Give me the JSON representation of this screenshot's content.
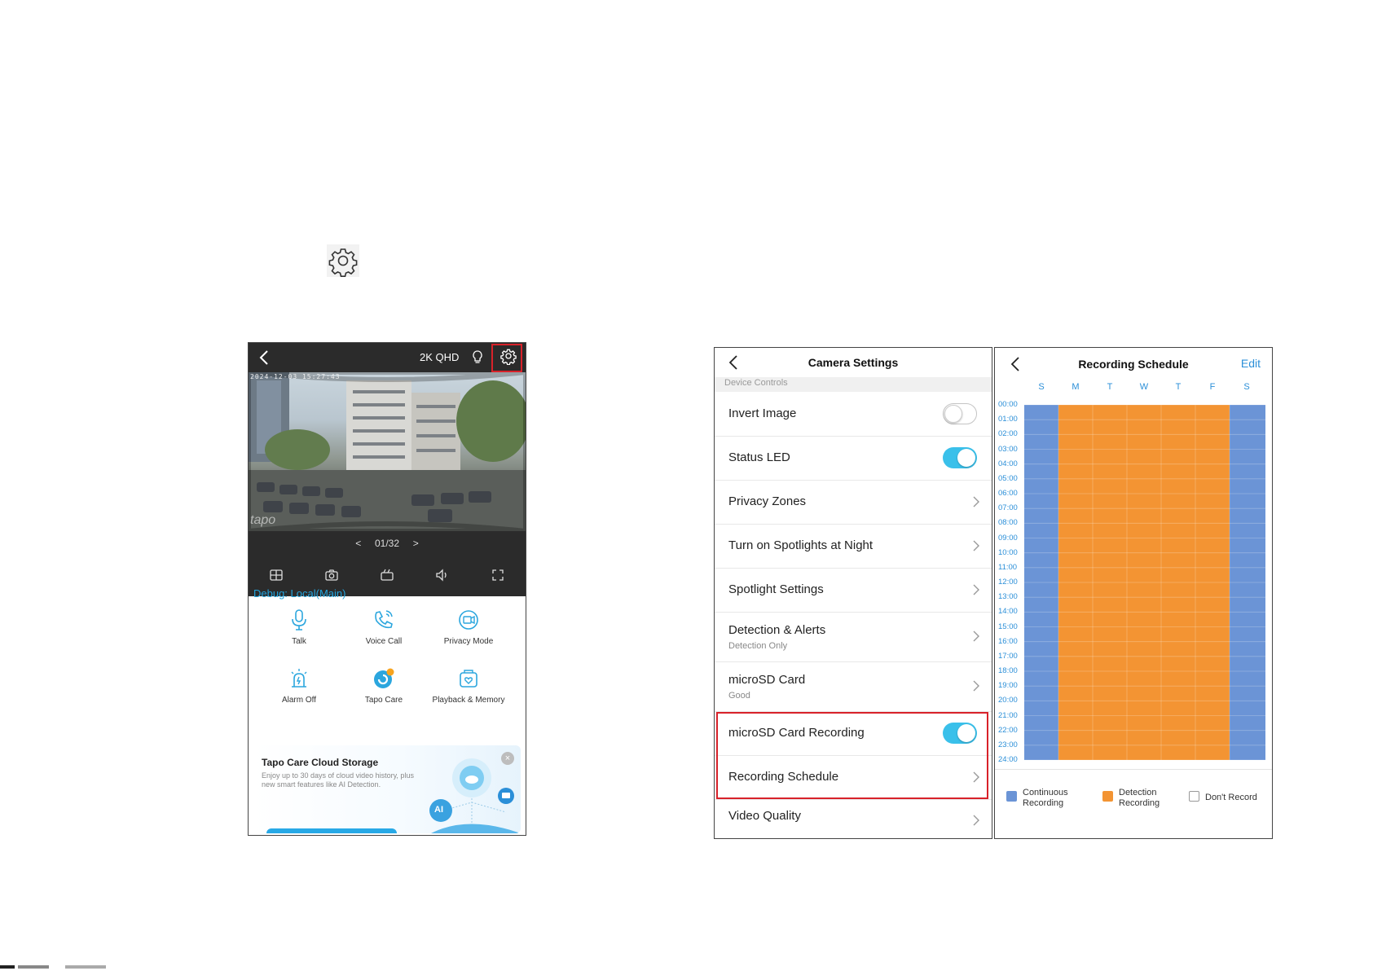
{
  "phone1": {
    "resolution": "2K QHD",
    "timestamp": "2024-12-03 15:27:43",
    "watermark": "tapo",
    "pager": {
      "prev": "<",
      "text": "01/32",
      "next": ">"
    },
    "debug_label": "Debug: Local(Main)",
    "features": [
      {
        "label": "Talk",
        "icon": "microphone-icon"
      },
      {
        "label": "Voice Call",
        "icon": "phone-call-icon"
      },
      {
        "label": "Privacy Mode",
        "icon": "privacy-mode-icon"
      },
      {
        "label": "Alarm Off",
        "icon": "alarm-icon"
      },
      {
        "label": "Tapo Care",
        "icon": "tapo-care-icon"
      },
      {
        "label": "Playback & Memory",
        "icon": "playback-memory-icon"
      }
    ],
    "banner": {
      "title": "Tapo Care Cloud Storage",
      "body": "Enjoy up to 30 days of cloud video history, plus new smart features like AI Detection.",
      "close": "×",
      "ai_badge": "AI"
    }
  },
  "settings": {
    "title": "Camera Settings",
    "section": "Device Controls",
    "rows": [
      {
        "label": "Invert Image",
        "toggle": "off"
      },
      {
        "label": "Status LED",
        "toggle": "on"
      },
      {
        "label": "Privacy Zones"
      },
      {
        "label": "Turn on Spotlights at Night"
      },
      {
        "label": "Spotlight Settings"
      },
      {
        "label": "Detection & Alerts",
        "sub": "Detection Only"
      },
      {
        "label": "microSD Card",
        "sub": "Good"
      },
      {
        "label": "microSD Card Recording",
        "toggle": "on"
      },
      {
        "label": "Recording Schedule"
      },
      {
        "label": "Video Quality"
      }
    ]
  },
  "schedule": {
    "title": "Recording Schedule",
    "edit": "Edit",
    "days": [
      "S",
      "M",
      "T",
      "W",
      "T",
      "F",
      "S"
    ],
    "hours": [
      "00:00",
      "01:00",
      "02:00",
      "03:00",
      "04:00",
      "05:00",
      "06:00",
      "07:00",
      "08:00",
      "09:00",
      "10:00",
      "11:00",
      "12:00",
      "13:00",
      "14:00",
      "15:00",
      "16:00",
      "17:00",
      "18:00",
      "19:00",
      "20:00",
      "21:00",
      "22:00",
      "23:00",
      "24:00"
    ],
    "day_modes": [
      "continuous",
      "detection",
      "detection",
      "detection",
      "detection",
      "detection",
      "continuous"
    ],
    "colors": {
      "continuous": "#6b94d6",
      "detection": "#f39433",
      "none": "#ffffff"
    },
    "legend": {
      "continuous": "Continuous Recording",
      "detection": "Detection Recording",
      "none": "Don't Record"
    }
  }
}
